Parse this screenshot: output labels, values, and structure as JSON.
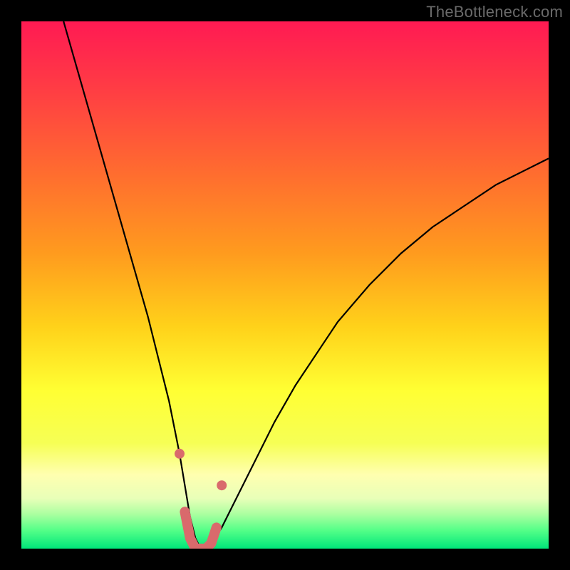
{
  "watermark": "TheBottleneck.com",
  "colors": {
    "frame": "#000000",
    "watermark": "#6a6a6a",
    "curve": "#000000",
    "marker_fill": "#d96a6c",
    "marker_stroke": "#d96a6c",
    "gradient_stops": [
      {
        "offset": 0.0,
        "color": "#ff1a53"
      },
      {
        "offset": 0.12,
        "color": "#ff3a45"
      },
      {
        "offset": 0.28,
        "color": "#ff6a30"
      },
      {
        "offset": 0.44,
        "color": "#ff9b1e"
      },
      {
        "offset": 0.58,
        "color": "#ffd21a"
      },
      {
        "offset": 0.7,
        "color": "#ffff33"
      },
      {
        "offset": 0.8,
        "color": "#f6ff55"
      },
      {
        "offset": 0.86,
        "color": "#ffffb0"
      },
      {
        "offset": 0.905,
        "color": "#e8ffb8"
      },
      {
        "offset": 0.935,
        "color": "#aaffa0"
      },
      {
        "offset": 0.965,
        "color": "#55ff88"
      },
      {
        "offset": 1.0,
        "color": "#00e67a"
      }
    ]
  },
  "chart_data": {
    "type": "line",
    "title": "",
    "xlabel": "",
    "ylabel": "",
    "xlim": [
      0,
      100
    ],
    "ylim": [
      0,
      100
    ],
    "x": [
      8,
      12,
      16,
      20,
      24,
      26,
      28,
      30,
      31,
      32,
      33,
      34,
      35,
      36,
      38,
      40,
      44,
      48,
      52,
      56,
      60,
      66,
      72,
      78,
      84,
      90,
      96,
      100
    ],
    "values": [
      100,
      86,
      72,
      58,
      44,
      36,
      28,
      18,
      12,
      6,
      2,
      0,
      0,
      1,
      4,
      8,
      16,
      24,
      31,
      37,
      43,
      50,
      56,
      61,
      65,
      69,
      72,
      74
    ],
    "markers": {
      "x": [
        30,
        31,
        32,
        33,
        34,
        35,
        36,
        37,
        38
      ],
      "y": [
        18,
        7,
        2,
        0,
        0,
        0,
        1,
        4,
        12
      ]
    }
  }
}
